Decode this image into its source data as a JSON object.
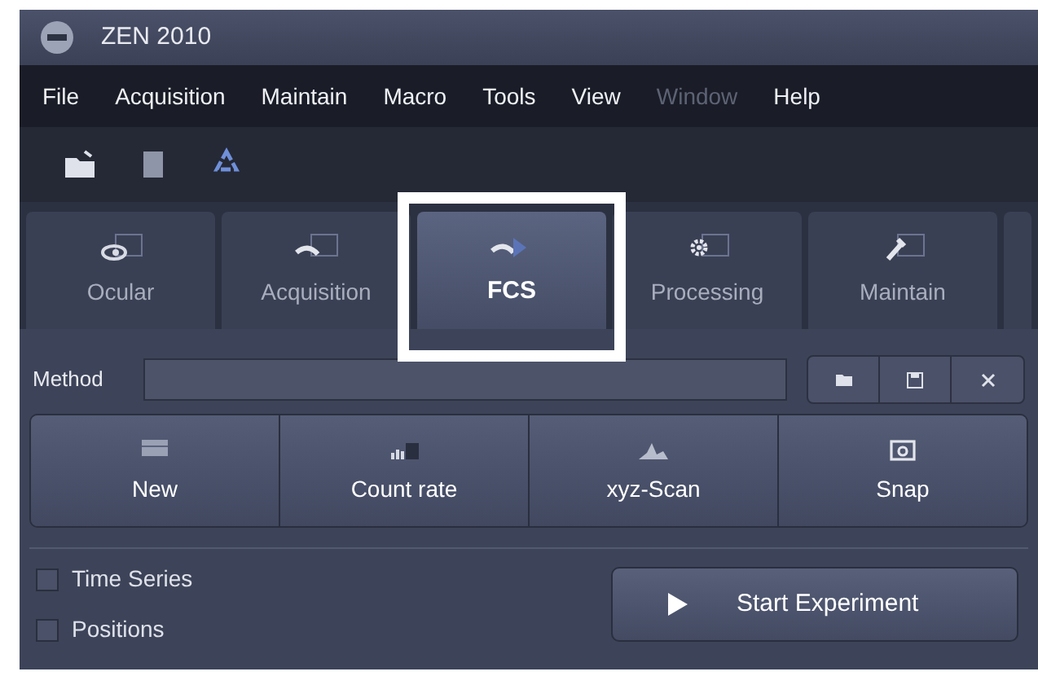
{
  "window": {
    "title": "ZEN 2010"
  },
  "menu": [
    {
      "label": "File",
      "disabled": false
    },
    {
      "label": "Acquisition",
      "disabled": false
    },
    {
      "label": "Maintain",
      "disabled": false
    },
    {
      "label": "Macro",
      "disabled": false
    },
    {
      "label": "Tools",
      "disabled": false
    },
    {
      "label": "View",
      "disabled": false
    },
    {
      "label": "Window",
      "disabled": true
    },
    {
      "label": "Help",
      "disabled": false
    }
  ],
  "tabs": [
    {
      "label": "Ocular",
      "kind": "eye",
      "selected": false
    },
    {
      "label": "Acquisition",
      "kind": "curve",
      "selected": false
    },
    {
      "label": "FCS",
      "kind": "fcs",
      "selected": true
    },
    {
      "label": "Processing",
      "kind": "gear",
      "selected": false
    },
    {
      "label": "Maintain",
      "kind": "wrench",
      "selected": false
    }
  ],
  "method": {
    "label": "Method"
  },
  "actions": [
    {
      "label": "New",
      "kind": "new"
    },
    {
      "label": "Count rate",
      "kind": "count"
    },
    {
      "label": "xyz-Scan",
      "kind": "scan"
    },
    {
      "label": "Snap",
      "kind": "snap"
    }
  ],
  "options": [
    {
      "label": "Time Series",
      "checked": false
    },
    {
      "label": "Positions",
      "checked": false
    }
  ],
  "start": {
    "label": "Start Experiment"
  }
}
